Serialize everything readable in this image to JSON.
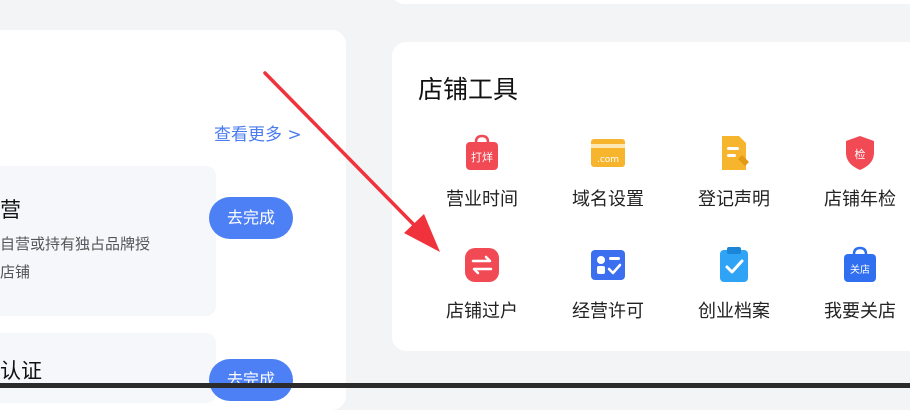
{
  "left": {
    "see_more": "查看更多 >",
    "task1": {
      "title": "营",
      "desc1": "自营或持有独占品牌授",
      "desc2": "店铺",
      "button": "去完成"
    },
    "task2": {
      "title": "认证",
      "button": "去完成"
    }
  },
  "tools": {
    "title": "店铺工具",
    "items": [
      {
        "label": "营业时间",
        "icon": "shop-bag-icon",
        "icon_text": "打烊",
        "color": "#f24a55"
      },
      {
        "label": "域名设置",
        "icon": "domain-card-icon",
        "icon_text": ".com",
        "color": "#f7b52e"
      },
      {
        "label": "登记声明",
        "icon": "document-edit-icon",
        "icon_text": "",
        "color": "#f7b52e"
      },
      {
        "label": "店铺年检",
        "icon": "shield-check-icon",
        "icon_text": "检",
        "color": "#f24a55"
      },
      {
        "label": "店铺过户",
        "icon": "transfer-icon",
        "icon_text": "",
        "color": "#f24a55"
      },
      {
        "label": "经营许可",
        "icon": "license-icon",
        "icon_text": "",
        "color": "#3b6ff0"
      },
      {
        "label": "创业档案",
        "icon": "clipboard-check-icon",
        "icon_text": "",
        "color": "#2fa3f5"
      },
      {
        "label": "我要关店",
        "icon": "close-shop-icon",
        "icon_text": "关店",
        "color": "#2f6ff0"
      }
    ]
  }
}
